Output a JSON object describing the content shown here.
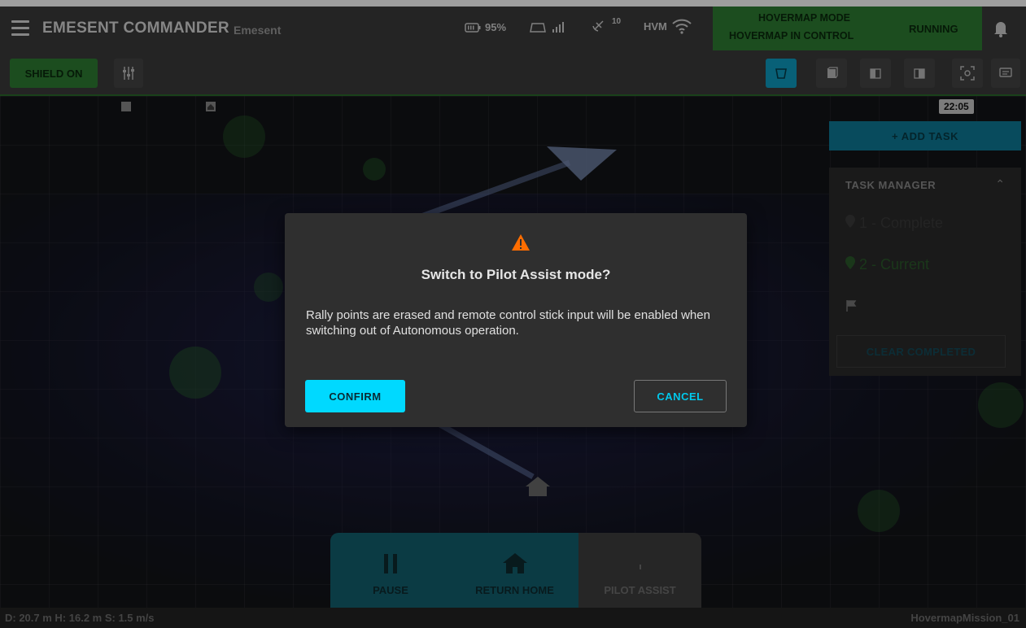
{
  "header": {
    "app_title": "EMESENT COMMANDER",
    "org": "Emesent",
    "battery": "95%",
    "gps_count": "10",
    "link_label": "HVM",
    "mode_line1": "HOVERMAP MODE",
    "mode_line2": "HOVERMAP IN CONTROL",
    "mode_status": "RUNNING"
  },
  "toolbar": {
    "shield_label": "SHIELD ON"
  },
  "map": {
    "time": "22:05"
  },
  "tasks": {
    "add_label": "+ ADD TASK",
    "manager_label": "TASK MANAGER",
    "items": [
      "1 - Complete",
      "2 - Current"
    ],
    "clear_label": "CLEAR COMPLETED"
  },
  "dialog": {
    "title": "Switch to Pilot Assist mode?",
    "message": "Rally points are erased and remote control stick input will be enabled when switching out of Autonomous operation.",
    "confirm_label": "CONFIRM",
    "cancel_label": "CANCEL"
  },
  "controls": {
    "pause_label": "PAUSE",
    "home_label": "RETURN HOME",
    "pilot_label": "PILOT ASSIST"
  },
  "status": {
    "left": "D: 20.7 m  H: 16.2 m  S: 1.5 m/s",
    "mission": "HovermapMission_01"
  },
  "colors": {
    "accent": "#00d9ff",
    "mode_green": "#2e7d32",
    "warning": "#ff6d00"
  }
}
